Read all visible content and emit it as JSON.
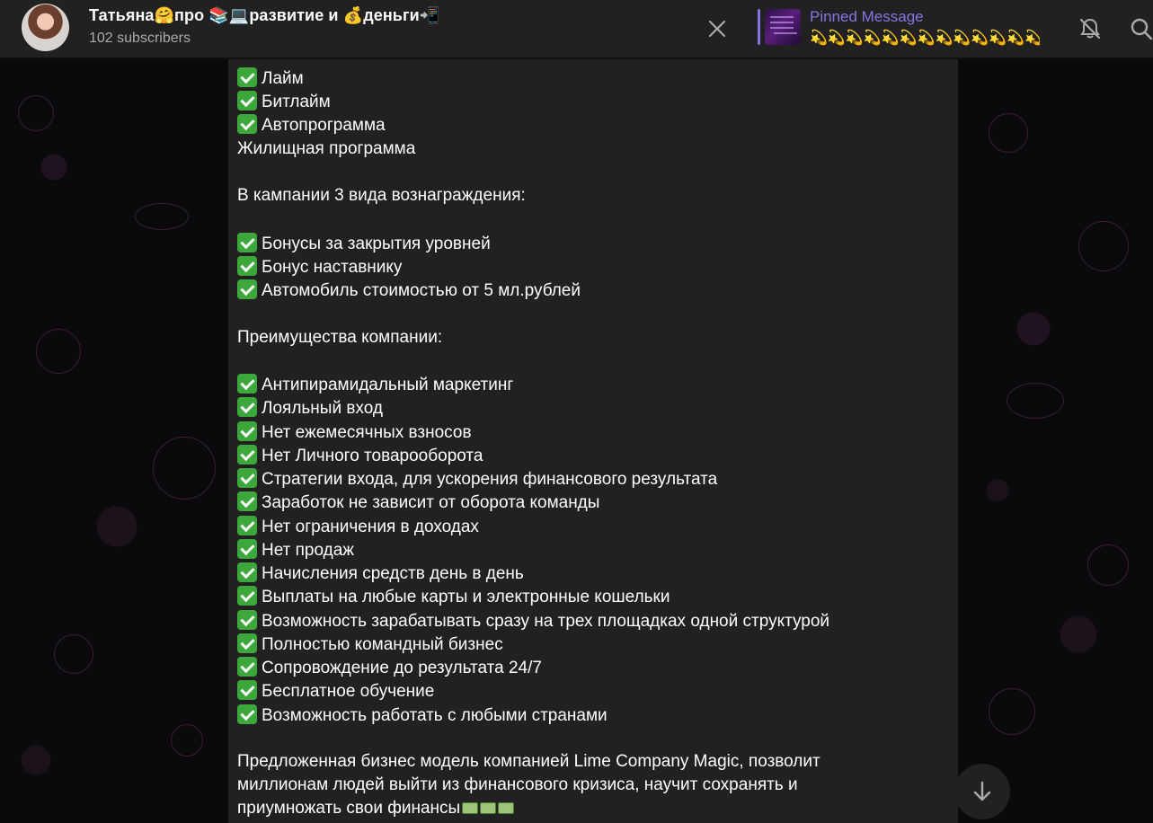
{
  "header": {
    "title": "Татьяна🤗про 📚💻развитие и 💰деньги📲",
    "subscribers": "102 subscribers",
    "pinned_label": "Pinned Message",
    "pinned_text": "💫💫💫💫💫💫💫💫💫💫💫💫💫...",
    "icons": [
      "close-icon",
      "bell-off-icon",
      "search-icon"
    ]
  },
  "message": {
    "lines": [
      {
        "check": true,
        "text": "Лайм"
      },
      {
        "check": true,
        "text": "Битлайм"
      },
      {
        "check": true,
        "text": "Автопрограмма"
      },
      {
        "check": false,
        "text": "Жилищная программа"
      },
      {
        "check": false,
        "text": "В кампании 3 вида вознаграждения:"
      },
      {
        "check": true,
        "text": "Бонусы за закрытия уровней"
      },
      {
        "check": true,
        "text": "Бонус наставнику"
      },
      {
        "check": true,
        "text": "Автомобиль стоимостью от 5 мл.рублей"
      },
      {
        "check": false,
        "text": "Преимущества компании:"
      },
      {
        "check": true,
        "text": "Антипирамидальный маркетинг"
      },
      {
        "check": true,
        "text": "Лояльный вход"
      },
      {
        "check": true,
        "text": "Нет ежемесячных взносов"
      },
      {
        "check": true,
        "text": "Нет Личного товарооборота"
      },
      {
        "check": true,
        "text": "Стратегии входа, для ускорения финансового результата"
      },
      {
        "check": true,
        "text": "Заработок не зависит от оборота команды"
      },
      {
        "check": true,
        "text": "Нет ограничения в доходах"
      },
      {
        "check": true,
        "text": "Нет продаж"
      },
      {
        "check": true,
        "text": "Начисления средств день в день"
      },
      {
        "check": true,
        "text": "Выплаты на любые карты и электронные кошельки"
      },
      {
        "check": true,
        "text": "Возможность зарабатывать сразу на трех площадках одной структурой"
      },
      {
        "check": true,
        "text": "Полностью командный бизнес"
      },
      {
        "check": true,
        "text": "Сопровождение до результата 24/7"
      },
      {
        "check": true,
        "text": "Бесплатное обучение"
      },
      {
        "check": true,
        "text": "Возможность работать с любыми странами"
      },
      {
        "check": false,
        "text": "Предложенная бизнес модель компанией Lime Company Magic, позволит"
      },
      {
        "check": false,
        "text": "миллионам людей выйти из финансового кризиса, научит сохранять и"
      },
      {
        "check": false,
        "text": "приумножать свои финансы"
      }
    ]
  },
  "colors": {
    "accent": "#8774e1",
    "bubble": "#212121",
    "header": "#212121",
    "check": "#3ca83c"
  }
}
